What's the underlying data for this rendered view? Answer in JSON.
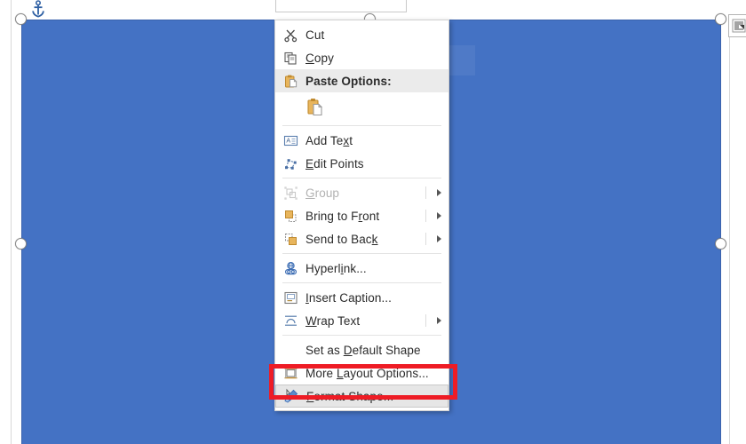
{
  "document": {
    "shape": {
      "name": "blue-rectangle-shape",
      "fill_color": "#4472C4",
      "border_color": "#3B63AD",
      "selected": true
    },
    "anchor_icon": "anchor-icon",
    "layout_options_button": "layout-options-icon"
  },
  "context_menu": {
    "items": [
      {
        "id": "cut",
        "label": "Cut",
        "icon": "scissors-icon",
        "type": "item",
        "underline": "",
        "submenu": false,
        "disabled": false
      },
      {
        "id": "copy",
        "label": "Copy",
        "icon": "copy-icon",
        "type": "item",
        "underline": "C",
        "submenu": false,
        "disabled": false
      },
      {
        "id": "paste-options",
        "label": "Paste Options:",
        "icon": "clipboard-icon",
        "type": "header",
        "underline": "",
        "submenu": false,
        "disabled": false
      },
      {
        "id": "paste-keep-source",
        "label": "",
        "icon": "paste-clipboard-icon",
        "type": "gallery",
        "underline": "",
        "submenu": false,
        "disabled": false
      },
      {
        "id": "separator-1",
        "label": "",
        "icon": "",
        "type": "separator",
        "underline": "",
        "submenu": false,
        "disabled": false
      },
      {
        "id": "add-text",
        "label": "Add Text",
        "icon": "add-text-icon",
        "type": "item",
        "underline": "x",
        "submenu": false,
        "disabled": false
      },
      {
        "id": "edit-points",
        "label": "Edit Points",
        "icon": "edit-points-icon",
        "type": "item",
        "underline": "E",
        "submenu": false,
        "disabled": false
      },
      {
        "id": "separator-2",
        "label": "",
        "icon": "",
        "type": "separator",
        "underline": "",
        "submenu": false,
        "disabled": false
      },
      {
        "id": "group",
        "label": "Group",
        "icon": "group-icon",
        "type": "item",
        "underline": "G",
        "submenu": true,
        "disabled": true
      },
      {
        "id": "bring-to-front",
        "label": "Bring to Front",
        "icon": "bring-front-icon",
        "type": "item",
        "underline": "r",
        "submenu": true,
        "disabled": false
      },
      {
        "id": "send-to-back",
        "label": "Send to Back",
        "icon": "send-back-icon",
        "type": "item",
        "underline": "k",
        "submenu": true,
        "disabled": false
      },
      {
        "id": "separator-3",
        "label": "",
        "icon": "",
        "type": "separator",
        "underline": "",
        "submenu": false,
        "disabled": false
      },
      {
        "id": "hyperlink",
        "label": "Hyperlink...",
        "icon": "hyperlink-icon",
        "type": "item",
        "underline": "i",
        "submenu": false,
        "disabled": false
      },
      {
        "id": "separator-4",
        "label": "",
        "icon": "",
        "type": "separator",
        "underline": "",
        "submenu": false,
        "disabled": false
      },
      {
        "id": "insert-caption",
        "label": "Insert Caption...",
        "icon": "insert-caption-icon",
        "type": "item",
        "underline": "I",
        "submenu": false,
        "disabled": false
      },
      {
        "id": "wrap-text",
        "label": "Wrap Text",
        "icon": "wrap-text-icon",
        "type": "item",
        "underline": "W",
        "submenu": true,
        "disabled": false
      },
      {
        "id": "separator-5",
        "label": "",
        "icon": "",
        "type": "separator",
        "underline": "",
        "submenu": false,
        "disabled": false
      },
      {
        "id": "set-as-default-shape",
        "label": "Set as Default Shape",
        "icon": "",
        "type": "item",
        "underline": "D",
        "submenu": false,
        "disabled": false
      },
      {
        "id": "more-layout-options",
        "label": "More Layout Options...",
        "icon": "more-layout-icon",
        "type": "item",
        "underline": "L",
        "submenu": false,
        "disabled": false
      },
      {
        "id": "format-shape",
        "label": "Format Shape...",
        "icon": "format-shape-icon",
        "type": "item",
        "underline": "F",
        "submenu": false,
        "disabled": false,
        "selected": true
      }
    ]
  },
  "annotation": {
    "highlight_color": "#EE1C25",
    "target_item": "Format Shape...",
    "shape": "rectangle-outline"
  }
}
